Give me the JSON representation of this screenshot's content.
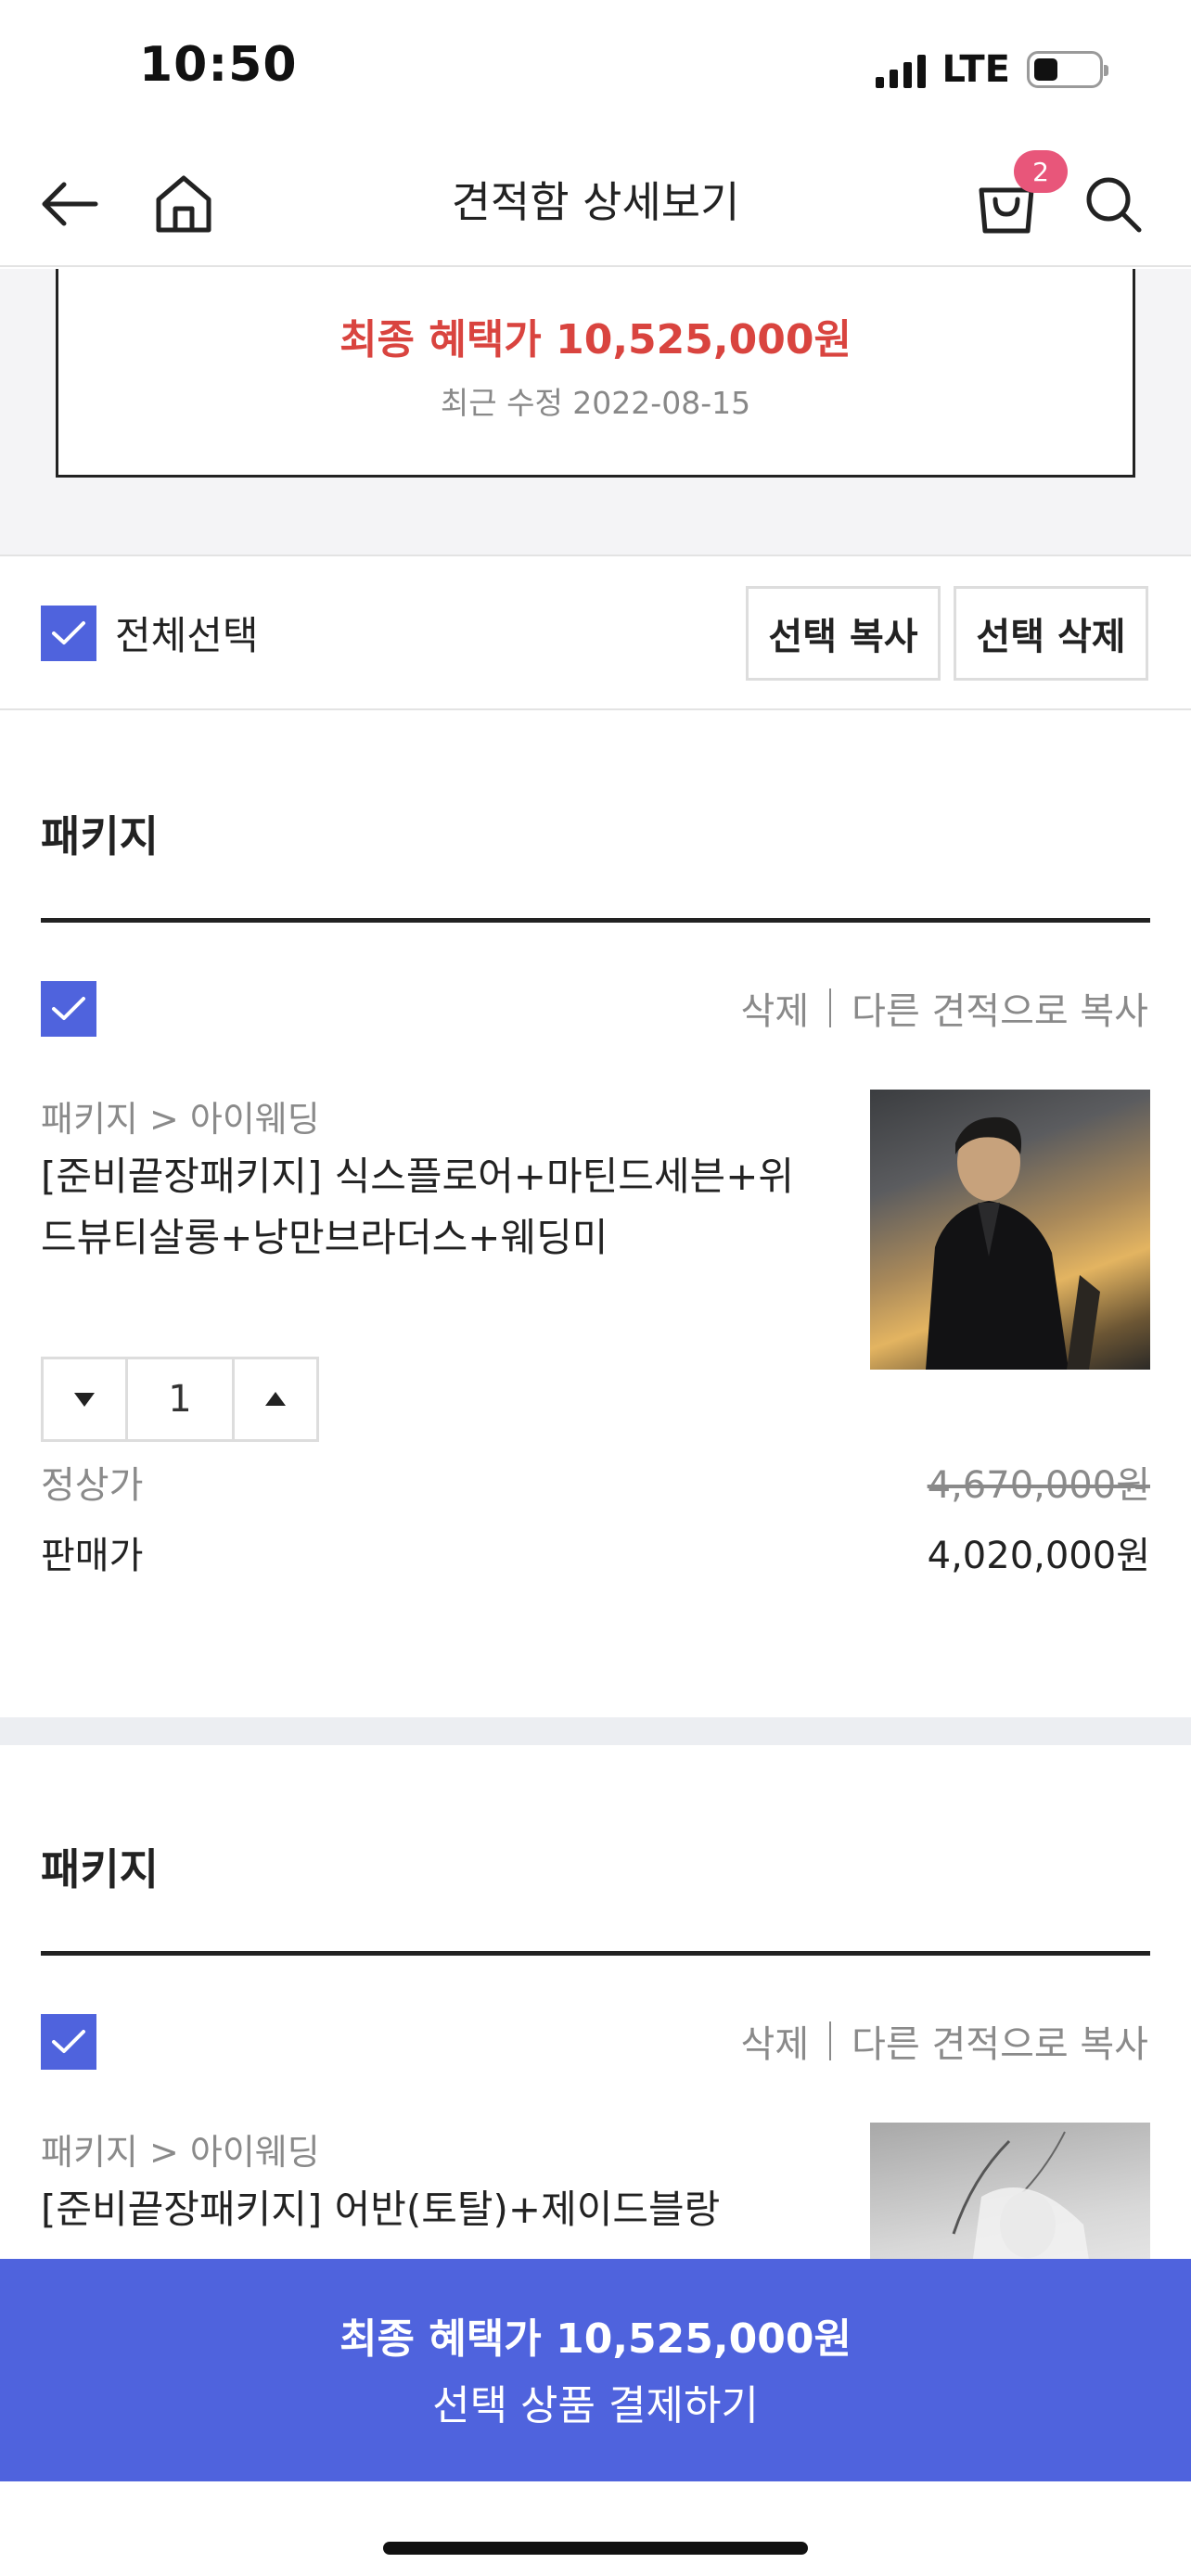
{
  "status_bar": {
    "time": "10:50",
    "network": "LTE"
  },
  "header": {
    "title": "견적함 상세보기",
    "cart_count": "2",
    "icons": [
      "back-arrow-icon",
      "home-icon",
      "shopping-bag-icon",
      "search-icon"
    ]
  },
  "summary": {
    "final_price": "최종 혜택가 10,525,000원",
    "modified": "최근 수정 2022-08-15"
  },
  "selection": {
    "select_all_label": "전체선택",
    "select_all_checked": true,
    "copy_label": "선택 복사",
    "delete_label": "선택 삭제"
  },
  "packages": [
    {
      "section_title": "패키지",
      "checked": true,
      "delete_label": "삭제",
      "copy_label": "다른 견적으로 복사",
      "category": "패키지 > 아이웨딩",
      "name": "[준비끝장패키지] 식스플로어+마틴드세븐+위드뷰티살롱+낭만브라더스+웨딩미",
      "quantity": "1",
      "regular_label": "정상가",
      "regular_price": "4,670,000원",
      "sale_label": "판매가",
      "sale_price": "4,020,000원"
    },
    {
      "section_title": "패키지",
      "checked": true,
      "delete_label": "삭제",
      "copy_label": "다른 견적으로 복사",
      "category": "패키지 > 아이웨딩",
      "name": "[준비끝장패키지] 어반(토탈)+제이드블랑"
    }
  ],
  "cta": {
    "final_price": "최종 혜택가 10,525,000원",
    "label": "선택 상품 결제하기"
  },
  "colors": {
    "accent": "#4f63dd",
    "price_red": "#d9443f",
    "badge": "#e8567a"
  }
}
